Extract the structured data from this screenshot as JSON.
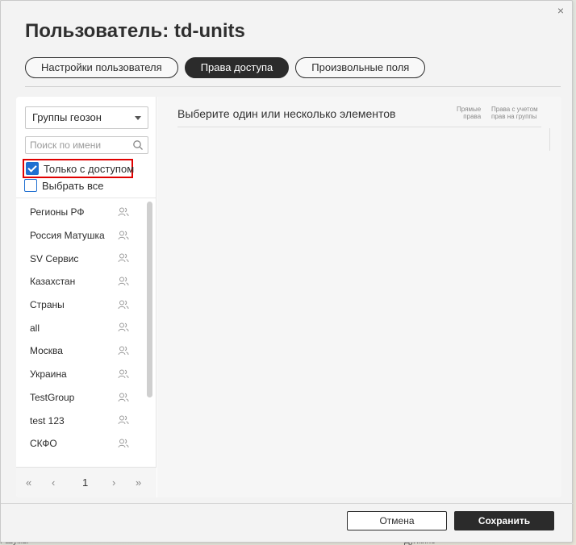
{
  "dialog": {
    "title": "Пользователь: td-units",
    "close_glyph": "×"
  },
  "tabs": [
    {
      "label": "Настройки пользователя",
      "active": false
    },
    {
      "label": "Права доступа",
      "active": true
    },
    {
      "label": "Произвольные поля",
      "active": false
    }
  ],
  "left": {
    "group_select": {
      "value": "Группы геозон"
    },
    "search": {
      "placeholder": "Поиск по имени",
      "value": ""
    },
    "only_with_access": {
      "label": "Только с доступом",
      "checked": true
    },
    "select_all": {
      "label": "Выбрать все",
      "checked": false
    },
    "items": [
      {
        "label": "Регионы РФ",
        "icon": "users-icon"
      },
      {
        "label": "Россия Матушка",
        "icon": "users-icon"
      },
      {
        "label": "SV Сервис",
        "icon": "users-icon"
      },
      {
        "label": "Казахстан",
        "icon": "users-icon"
      },
      {
        "label": "Страны",
        "icon": "users-icon"
      },
      {
        "label": "all",
        "icon": "users-icon"
      },
      {
        "label": "Москва",
        "icon": "users-icon"
      },
      {
        "label": "Украина",
        "icon": "users-icon"
      },
      {
        "label": "TestGroup",
        "icon": "users-icon"
      },
      {
        "label": "test 123",
        "icon": "users-icon"
      },
      {
        "label": "СКФО",
        "icon": "users-icon"
      }
    ],
    "pager": {
      "first": "«",
      "prev": "‹",
      "page": "1",
      "next": "›",
      "last": "»"
    }
  },
  "right": {
    "title": "Выберите один или несколько элементов",
    "col_direct": [
      "Прямые",
      "права"
    ],
    "col_with_groups": [
      "Права с учетом",
      "прав на группы"
    ]
  },
  "footer": {
    "cancel_label": "Отмена",
    "save_label": "Сохранить"
  },
  "colors": {
    "accent": "#2b2b2b",
    "checkbox": "#1f6fd1",
    "highlight": "#e00000"
  },
  "background_map": {
    "labels": [
      "Разумы",
      "Дулкино"
    ]
  }
}
